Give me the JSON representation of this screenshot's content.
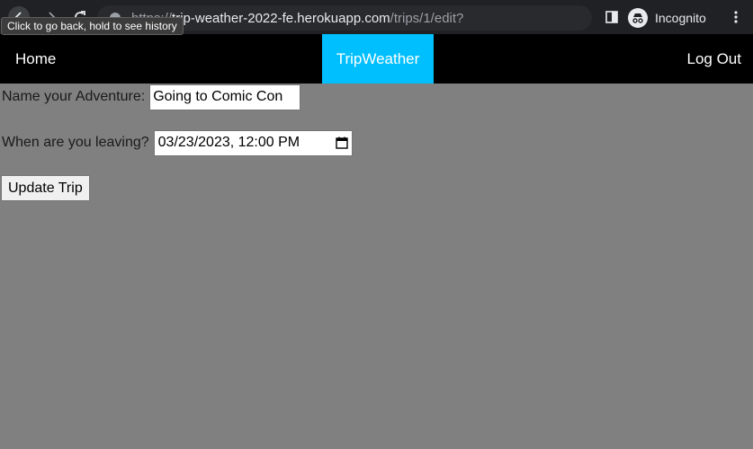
{
  "browser": {
    "url_scheme": "https://",
    "url_host": "trip-weather-2022-fe.herokuapp.com",
    "url_path": "/trips/1/edit?",
    "profile_label": "Incognito",
    "tooltip": "Click to go back, hold to see history",
    "icons": [
      "back-arrow-icon",
      "forward-arrow-icon",
      "reload-icon",
      "site-info-icon",
      "side-panel-icon",
      "incognito-icon",
      "more-vert-icon"
    ]
  },
  "nav": {
    "home": "Home",
    "brand": "TripWeather",
    "logout": "Log Out",
    "brand_color": "#00bfff",
    "bar_color": "#000000"
  },
  "form": {
    "name_label": "Name your Adventure:",
    "name_value": "Going to Comic Con",
    "date_label": "When are you leaving?",
    "date_value": "03/23/2023, 12:00 PM",
    "submit_label": "Update Trip"
  },
  "page": {
    "background": "#808080"
  }
}
